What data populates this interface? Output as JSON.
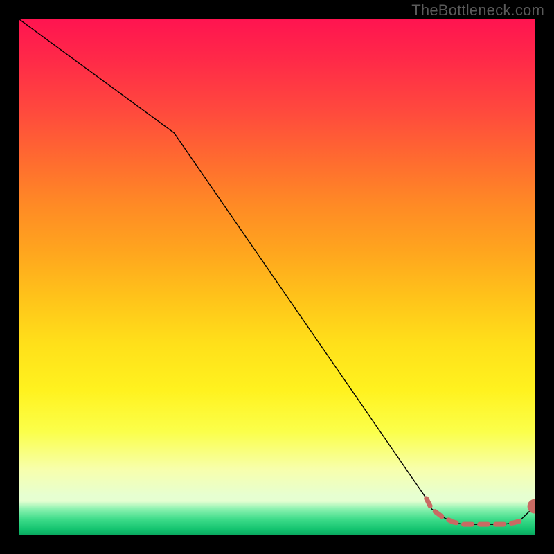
{
  "watermark": "TheBottleneck.com",
  "colors": {
    "page_bg": "#000000",
    "line": "#000000",
    "dashed_line": "#c96a63",
    "dot": "#c96a63",
    "gradient_top": "#ff1450",
    "gradient_mid": "#ffe01a",
    "gradient_bottom": "#0aa860"
  },
  "chart_data": {
    "type": "line",
    "title": "",
    "xlabel": "",
    "ylabel": "",
    "xlim": [
      0,
      100
    ],
    "ylim": [
      0,
      100
    ],
    "grid": false,
    "series": [
      {
        "name": "curve",
        "style": "solid-thin-black",
        "x": [
          0,
          30,
          79,
          80,
          82,
          84,
          86,
          88,
          90,
          92,
          94,
          96,
          97,
          100
        ],
        "values": [
          100,
          78,
          7,
          5,
          3.5,
          2.5,
          2,
          2,
          2,
          2,
          2,
          2.3,
          2.6,
          5.5
        ]
      },
      {
        "name": "dashed-bottom",
        "style": "dashed-thick-salmon",
        "x": [
          79,
          80,
          82,
          84,
          86,
          88,
          90,
          92,
          94,
          96,
          97
        ],
        "values": [
          7,
          5,
          3.5,
          2.5,
          2,
          2,
          2,
          2,
          2,
          2.3,
          2.6
        ]
      }
    ],
    "points": [
      {
        "name": "end-dot",
        "x": 100,
        "y": 5.5,
        "color": "#c96a63",
        "r": 1.4
      }
    ]
  }
}
